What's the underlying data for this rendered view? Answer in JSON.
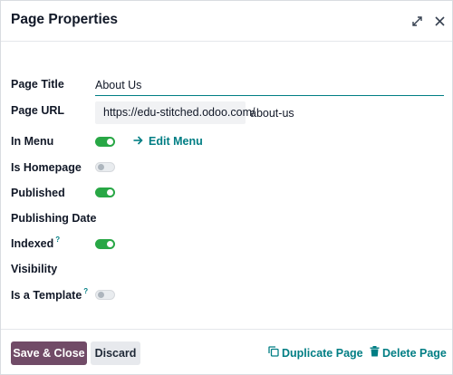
{
  "dialog": {
    "title": "Page Properties"
  },
  "fields": {
    "page_title_label": "Page Title",
    "page_title_value": "About Us",
    "page_url_label": "Page URL",
    "page_url_prefix": "https://edu-stitched.odoo.com/",
    "page_url_value": "about-us",
    "in_menu_label": "In Menu",
    "in_menu_on": true,
    "edit_menu_label": "Edit Menu",
    "is_homepage_label": "Is Homepage",
    "is_homepage_on": false,
    "published_label": "Published",
    "published_on": true,
    "publishing_date_label": "Publishing Date",
    "indexed_label": "Indexed",
    "indexed_on": true,
    "visibility_label": "Visibility",
    "is_template_label": "Is a Template",
    "is_template_on": false,
    "help_marker": "?"
  },
  "footer": {
    "save_label": "Save & Close",
    "discard_label": "Discard",
    "duplicate_label": "Duplicate Page",
    "delete_label": "Delete Page"
  },
  "colors": {
    "primary": "#714b67",
    "link": "#017e84",
    "toggle_on": "#28a745"
  },
  "icons": {
    "expand": "expand-icon",
    "close": "close-icon",
    "edit_menu": "arrow-right-icon",
    "duplicate": "copy-icon",
    "delete": "trash-icon"
  }
}
